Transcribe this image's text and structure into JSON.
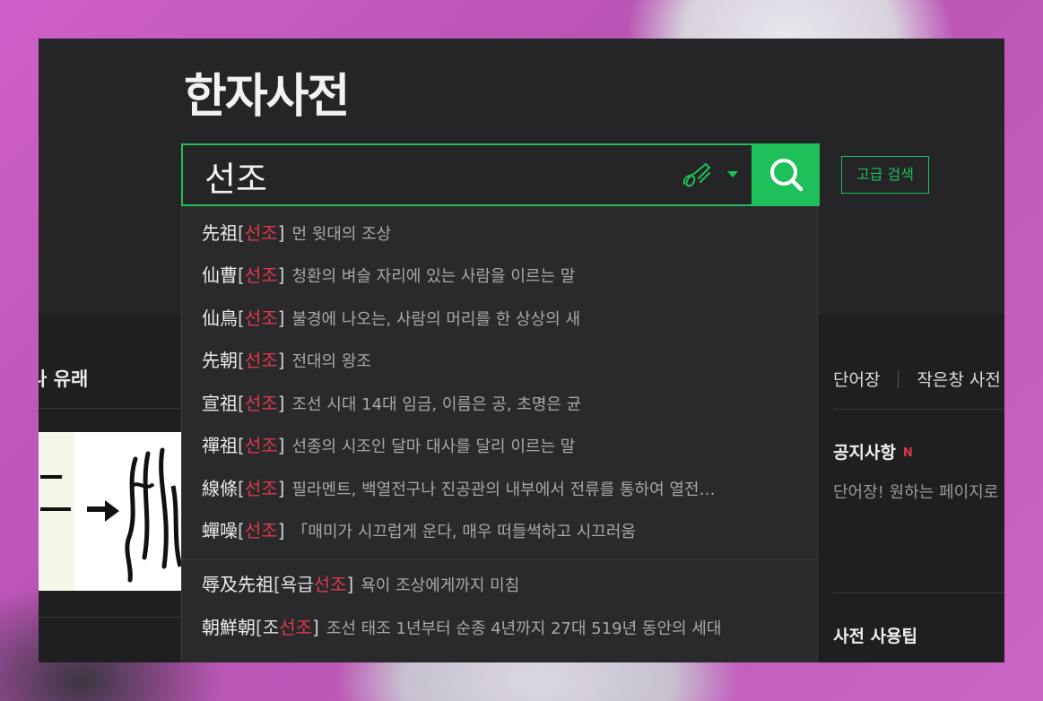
{
  "header": {
    "site_title": "한자사전"
  },
  "search": {
    "query": "선조",
    "advanced_label": "고급 검색"
  },
  "suggestions": [
    {
      "hanja": "先祖",
      "reading_prefix": "",
      "reading": "선조",
      "meaning": "먼 윗대의 조상"
    },
    {
      "hanja": "仙曹",
      "reading_prefix": "",
      "reading": "선조",
      "meaning": "청환의 벼슬 자리에 있는 사람을 이르는 말"
    },
    {
      "hanja": "仙鳥",
      "reading_prefix": "",
      "reading": "선조",
      "meaning": "불경에 나오는, 사람의 머리를 한 상상의 새"
    },
    {
      "hanja": "先朝",
      "reading_prefix": "",
      "reading": "선조",
      "meaning": "전대의 왕조"
    },
    {
      "hanja": "宣祖",
      "reading_prefix": "",
      "reading": "선조",
      "meaning": "조선 시대 14대 임금, 이름은 공, 초명은 균"
    },
    {
      "hanja": "禪祖",
      "reading_prefix": "",
      "reading": "선조",
      "meaning": "선종의 시조인 달마 대사를 달리 이르는 말"
    },
    {
      "hanja": "線條",
      "reading_prefix": "",
      "reading": "선조",
      "meaning": "필라멘트, 백열전구나 진공관의 내부에서 전류를 통하여 열전…"
    },
    {
      "hanja": "蟬噪",
      "reading_prefix": "",
      "reading": "선조",
      "meaning": "「매미가 시끄럽게 운다, 매우 떠들썩하고 시끄러움"
    },
    {
      "hanja": "辱及先祖",
      "reading_prefix": "욕급",
      "reading": "선조",
      "meaning": "욕이 조상에게까지 미침"
    },
    {
      "hanja": "朝鮮朝",
      "reading_prefix": "조",
      "reading": "선조",
      "meaning": "조선 태조 1년부터 순종 4년까지 27대 519년 동안의 세대"
    }
  ],
  "left_panel": {
    "heading": "나 유래"
  },
  "right_panel": {
    "tabs": [
      "단어장",
      "작은창 사전"
    ],
    "notice_title": "공지사항",
    "notice_badge": "N",
    "notice_text": "단어장! 원하는 페이지로",
    "tips_title": "사전 사용팁"
  },
  "colors": {
    "accent": "#1ec05a",
    "highlight": "#e0384a",
    "background": "#252527"
  }
}
